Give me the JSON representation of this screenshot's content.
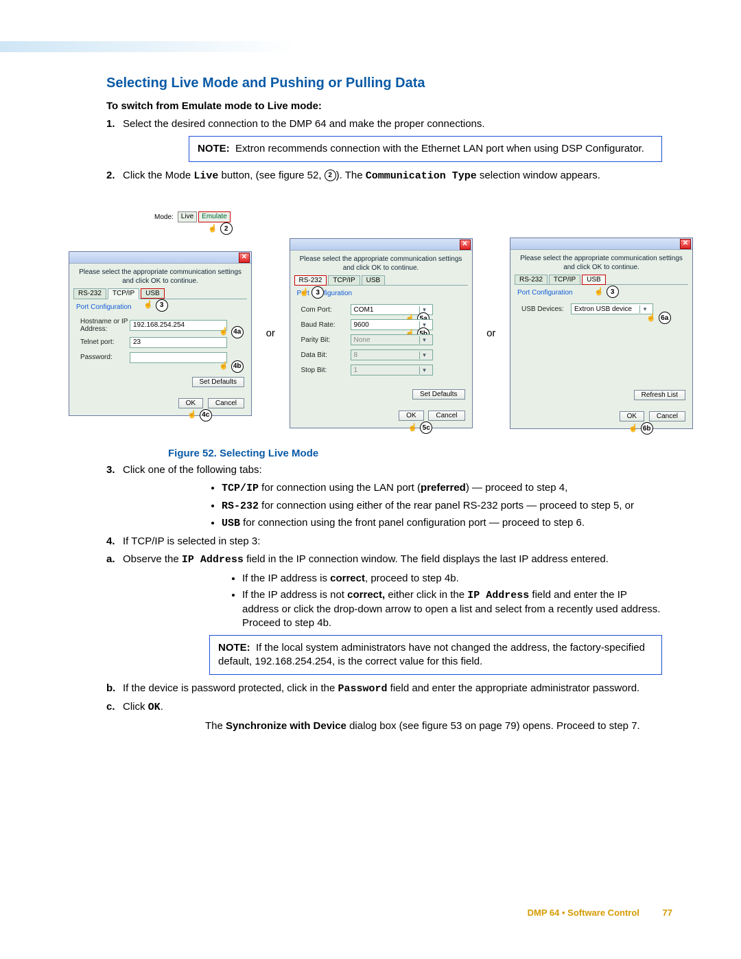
{
  "section_title": "Selecting Live Mode and Pushing or Pulling Data",
  "subhead1": "To switch from Emulate mode to Live mode:",
  "step1": "Select the desired connection to the DMP 64 and make the proper connections.",
  "note1_label": "NOTE:",
  "note1_text": "Extron recommends connection with the Ethernet LAN port when using DSP Configurator.",
  "step2_a": "Click the Mode ",
  "step2_live": "Live",
  "step2_b": " button, (see figure 52, ",
  "step2_callout": "2",
  "step2_c": "). The ",
  "step2_commtype": "Communication Type",
  "step2_d": " selection window appears.",
  "mode_bar": {
    "label": "Mode:",
    "btn_live": "Live",
    "btn_emulate": "Emulate",
    "callout": "2"
  },
  "or_label": "or",
  "dialog_msg": "Please select the appropriate communication settings and click OK to continue.",
  "tabs": {
    "rs232": "RS-232",
    "tcpip": "TCP/IP",
    "usb": "USB"
  },
  "port_config": "Port Configuration",
  "dlg1": {
    "host_lbl": "Hostname or IP Address:",
    "host_val": "192.168.254.254",
    "telnet_lbl": "Telnet port:",
    "telnet_val": "23",
    "pwd_lbl": "Password:",
    "pwd_val": "",
    "c3": "3",
    "c4a": "4a",
    "c4b": "4b",
    "c4c": "4c"
  },
  "dlg2": {
    "com_lbl": "Com Port:",
    "com_val": "COM1",
    "baud_lbl": "Baud Rate:",
    "baud_val": "9600",
    "parity_lbl": "Parity Bit:",
    "parity_val": "None",
    "data_lbl": "Data Bit:",
    "data_val": "8",
    "stop_lbl": "Stop Bit:",
    "stop_val": "1",
    "c3": "3",
    "c5a": "5a",
    "c5b": "5b",
    "c5c": "5c"
  },
  "dlg3": {
    "usb_lbl": "USB Devices:",
    "usb_val": "Extron USB device",
    "refresh": "Refresh List",
    "c3": "3",
    "c6a": "6a",
    "c6b": "6b"
  },
  "btn_setdef": "Set Defaults",
  "btn_ok": "OK",
  "btn_cancel": "Cancel",
  "fig_caption": "Figure 52. Selecting Live Mode",
  "step3": "Click one of the following tabs:",
  "s3b1_a": "TCP/IP",
  "s3b1_b": " for connection using the LAN port (",
  "s3b1_pref": "preferred",
  "s3b1_c": ") — proceed to step 4,",
  "s3b2_a": "RS-232",
  "s3b2_b": " for connection using either of the rear panel RS-232 ports — proceed to step 5, or",
  "s3b3_a": "USB",
  "s3b3_b": " for connection using the front panel configuration port — proceed to step 6.",
  "step4": "If TCP/IP is selected in step 3:",
  "s4a_a": "Observe the ",
  "s4a_ip": "IP Address",
  "s4a_b": " field in the IP connection window. The field displays the last IP address entered.",
  "s4a_bul1_a": "If the IP address is ",
  "s4a_bul1_b": "correct",
  "s4a_bul1_c": ", proceed to step 4b.",
  "s4a_bul2_a": "If the IP address is not ",
  "s4a_bul2_b": "correct,",
  "s4a_bul2_c": " either click in the ",
  "s4a_bul2_ip": "IP Address",
  "s4a_bul2_d": " field and enter the IP address or click the drop-down arrow to open a list and select from a recently used address. Proceed to step 4b.",
  "note2_label": "NOTE:",
  "note2_text": "If the local system administrators have not changed the address, the factory-specified default, 192.168.254.254, is the correct value for this field.",
  "s4b_a": "If the device is password protected, click in the ",
  "s4b_pwd": "Password",
  "s4b_b": " field and enter the appropriate administrator password.",
  "s4c_a": "Click ",
  "s4c_ok": "OK",
  "s4c_b": ".",
  "s4_sync_a": "The ",
  "s4_sync_b": "Synchronize with Device",
  "s4_sync_c": " dialog box (see figure 53 on page 79) opens. Proceed to step 7.",
  "footer_text": "DMP 64 • Software Control",
  "page_num": "77"
}
